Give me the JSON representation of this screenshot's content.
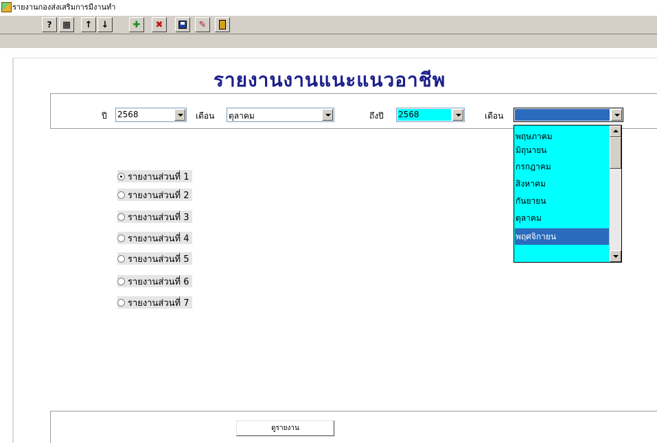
{
  "window": {
    "title": "รายงานกองส่งเสริมการมีงานทำ",
    "icon": "app-icon"
  },
  "toolbar": {
    "buttons": [
      {
        "name": "find-record-button",
        "icon": "search-doc-icon",
        "glyph": "🔍"
      },
      {
        "name": "list-view-button",
        "icon": "grid-icon",
        "glyph": "▦"
      },
      {
        "name": "prev-record-button",
        "icon": "arrow-up-icon",
        "glyph": "↑"
      },
      {
        "name": "next-record-button",
        "icon": "arrow-down-icon",
        "glyph": "↓"
      },
      {
        "name": "add-record-button",
        "icon": "add-doc-icon",
        "glyph": "✚"
      },
      {
        "name": "delete-record-button",
        "icon": "delete-doc-icon",
        "glyph": "✖"
      },
      {
        "name": "save-button",
        "icon": "floppy-disk-icon",
        "glyph": "💾"
      },
      {
        "name": "cancel-edit-button",
        "icon": "eraser-icon",
        "glyph": "✎"
      },
      {
        "name": "exit-button",
        "icon": "exit-door-icon",
        "glyph": "⏏"
      }
    ]
  },
  "report": {
    "title": "รายงานงานแนะแนวอาชีพ"
  },
  "filters": {
    "year_label": "ปี",
    "year_value": "2568",
    "month_label": "เดือน",
    "month_value": "ตุลาคม",
    "to_year_label": "ถึงปี",
    "to_year_value": "2568",
    "to_month_label": "เดือน",
    "to_month_value": ""
  },
  "month_dropdown": {
    "options": [
      "พฤษภาคม",
      "มิถุนายน",
      "กรกฎาคม",
      "สิงหาคม",
      "กันยายน",
      "ตุลาคม",
      "พฤศจิกายน",
      ""
    ],
    "selected_index": 6
  },
  "report_parts": {
    "options": [
      "รายงานส่วนที่ 1",
      "รายงานส่วนที่ 2",
      "รายงานส่วนที่ 3",
      "รายงานส่วนที่ 4",
      "รายงานส่วนที่ 5",
      "รายงานส่วนที่ 6",
      "รายงานส่วนที่ 7"
    ],
    "selected_index": 0
  },
  "actions": {
    "view_report_label": "ดูรายงาน"
  },
  "colors": {
    "title": "#1b1f8a",
    "highlight": "#00ffff",
    "selection": "#2a6bbd",
    "toolbar": "#d4d0c8"
  }
}
